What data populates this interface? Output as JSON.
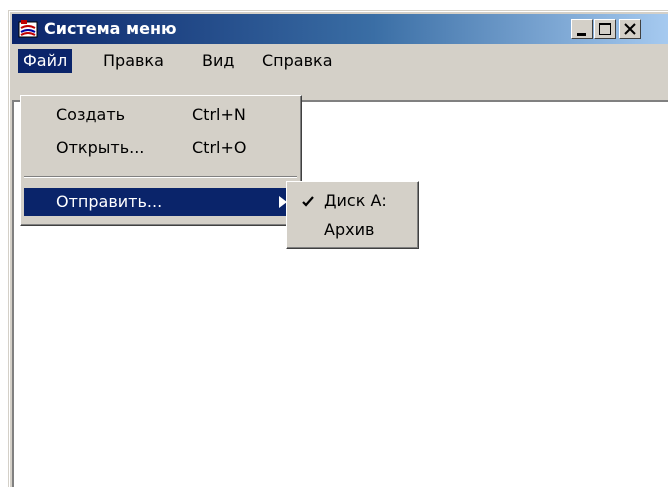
{
  "window": {
    "title": "Система меню",
    "icon": "app-icon"
  },
  "caption_buttons": {
    "minimize_icon": "minimize-icon",
    "maximize_icon": "maximize-icon",
    "close_icon": "close-icon"
  },
  "menubar": {
    "items": [
      {
        "label": "Файл",
        "active": true
      },
      {
        "label": "Правка",
        "active": false
      },
      {
        "label": "Вид",
        "active": false
      },
      {
        "label": "Справка",
        "active": false
      }
    ]
  },
  "file_menu": {
    "items": [
      {
        "label": "Создать",
        "shortcut": "Ctrl+N"
      },
      {
        "label": "Открыть...",
        "shortcut": "Ctrl+O"
      },
      {
        "label": "Отправить...",
        "has_submenu": true,
        "highlighted": true
      }
    ]
  },
  "send_submenu": {
    "items": [
      {
        "label": "Диск А:",
        "checked": true
      },
      {
        "label": "Архив",
        "checked": false
      }
    ]
  },
  "colors": {
    "selection": "#0a246a",
    "face": "#d4d0c8",
    "client": "#ffffff"
  }
}
